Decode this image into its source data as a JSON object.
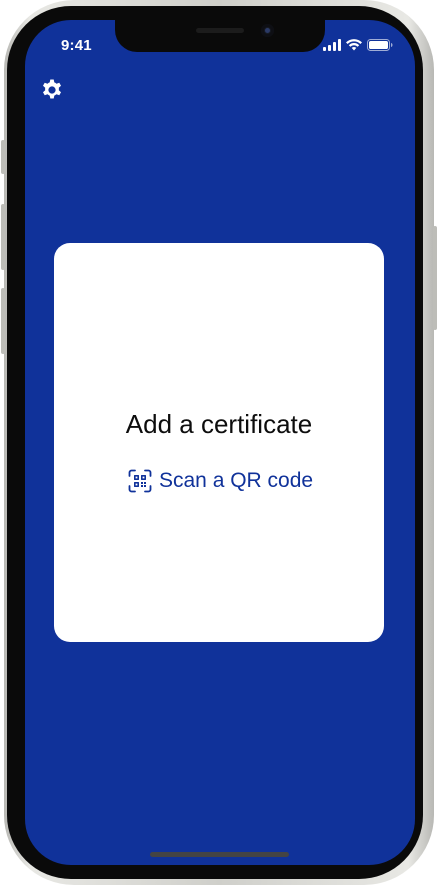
{
  "status_bar": {
    "time": "9:41",
    "icons": [
      "signal-icon",
      "wifi-icon",
      "battery-icon"
    ]
  },
  "header": {
    "settings_icon": "gear-icon"
  },
  "card": {
    "title": "Add a certificate",
    "scan_label": "Scan a QR code",
    "scan_icon": "qr-scan-icon"
  },
  "colors": {
    "background": "#10329a",
    "card": "#ffffff",
    "link": "#10329a",
    "title": "#0d0d0d"
  }
}
